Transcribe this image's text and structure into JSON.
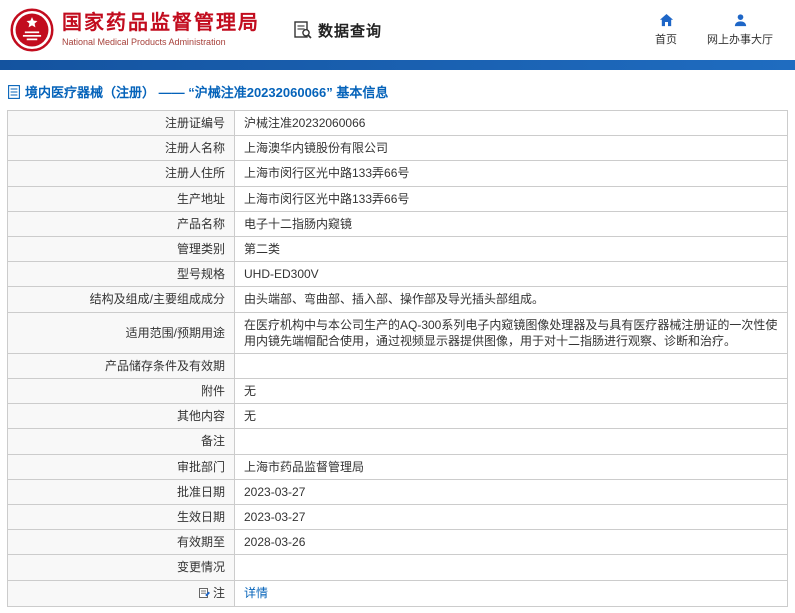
{
  "header": {
    "org_cn": "国家药品监督管理局",
    "org_en": "National Medical Products Administration",
    "section": "数据查询",
    "nav_home": "首页",
    "nav_hall": "网上办事大厅"
  },
  "title": "境内医疗器械（注册） —— “沪械注准20232060066” 基本信息",
  "colors": {
    "accent_red": "#c20c1e",
    "bar_blue": "#14539f",
    "link_blue": "#0563ba"
  },
  "table": {
    "rows": [
      {
        "label": "注册证编号",
        "value": "沪械注准20232060066"
      },
      {
        "label": "注册人名称",
        "value": "上海澳华内镜股份有限公司"
      },
      {
        "label": "注册人住所",
        "value": "上海市闵行区光中路133弄66号"
      },
      {
        "label": "生产地址",
        "value": "上海市闵行区光中路133弄66号"
      },
      {
        "label": "产品名称",
        "value": "电子十二指肠内窥镜"
      },
      {
        "label": "管理类别",
        "value": "第二类"
      },
      {
        "label": "型号规格",
        "value": "UHD-ED300V"
      },
      {
        "label": "结构及组成/主要组成成分",
        "value": "由头端部、弯曲部、插入部、操作部及导光插头部组成。"
      },
      {
        "label": "适用范围/预期用途",
        "value": "在医疗机构中与本公司生产的AQ-300系列电子内窥镜图像处理器及与具有医疗器械注册证的一次性使用内镜先端帽配合使用，通过视频显示器提供图像，用于对十二指肠进行观察、诊断和治疗。"
      },
      {
        "label": "产品储存条件及有效期",
        "value": ""
      },
      {
        "label": "附件",
        "value": "无"
      },
      {
        "label": "其他内容",
        "value": "无"
      },
      {
        "label": "备注",
        "value": ""
      },
      {
        "label": "审批部门",
        "value": "上海市药品监督管理局"
      },
      {
        "label": "批准日期",
        "value": "2023-03-27"
      },
      {
        "label": "生效日期",
        "value": "2023-03-27"
      },
      {
        "label": "有效期至",
        "value": "2028-03-26"
      },
      {
        "label": "变更情况",
        "value": ""
      },
      {
        "label": "注",
        "value": "详情",
        "value_is_link": true,
        "label_icon": "note-icon"
      }
    ]
  }
}
